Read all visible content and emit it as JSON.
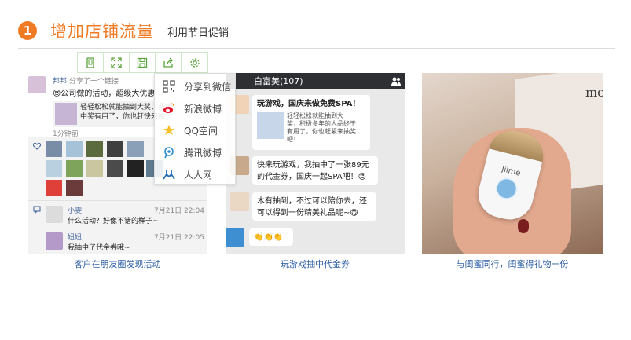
{
  "header": {
    "number": "1",
    "title": "增加店铺流量",
    "subtitle": "利用节日促销"
  },
  "toolbar": {
    "icons": [
      "phone-icon",
      "expand-icon",
      "save-icon",
      "share-icon",
      "settings-icon"
    ]
  },
  "panel1": {
    "poster_name": "邦邦",
    "poster_action": "分享了一个链接",
    "post_text": "😍公司做的活动，超级大优惠",
    "link_text_1": "轻轻松松就能抽到大奖，我抽",
    "link_text_2": "中奖有用了，你也赶快来抽",
    "time": "1分钟前",
    "comment1_name": "小雯",
    "comment1_time": "7月21日 22:04",
    "comment1_text": "什么活动？好像不错的样子~",
    "comment2_name": "妞妞",
    "comment2_time": "7月21日 22:05",
    "comment2_text": "我抽中了代金券哦~"
  },
  "share_menu": {
    "items": [
      {
        "label": "分享到微信",
        "icon": "wechat-qr-icon"
      },
      {
        "label": "新浪微博",
        "icon": "weibo-icon"
      },
      {
        "label": "QQ空间",
        "icon": "qzone-icon"
      },
      {
        "label": "腾讯微博",
        "icon": "tencent-weibo-icon"
      },
      {
        "label": "人人网",
        "icon": "renren-icon"
      }
    ]
  },
  "panel2": {
    "chat_title": "白富美(107)",
    "msg1_title": "玩游戏，国庆来做免费SPA！",
    "msg1_card_1": "轻轻松松就能抽到大",
    "msg1_card_2": "奖，积极多年的人品终于",
    "msg1_card_3": "有用了，你也赶紧来抽奖",
    "msg1_card_4": "吧！",
    "msg2_1": "快来玩游戏，我抽中了一张89元",
    "msg2_2": "的代金券，国庆一起SPA吧！😍",
    "msg3_1": "木有抽到，不过可以陪你去，还",
    "msg3_2": "可以得到一份精美礼品呢~😋",
    "msg4": "👏👏👏"
  },
  "panel3": {
    "device_brand": "Jilme",
    "box_text": "me"
  },
  "captions": {
    "c1": "客户在朋友圈发现活动",
    "c2": "玩游戏抽中代金券",
    "c3": "与闺蜜同行，闺蜜得礼物一份"
  },
  "colors": {
    "accent": "#f07b25",
    "caption": "#2d5fa6",
    "link_name": "#4a6aa0"
  }
}
